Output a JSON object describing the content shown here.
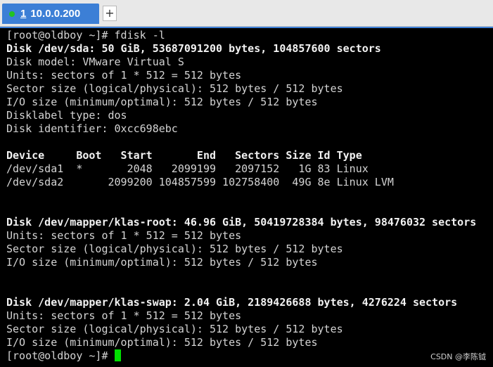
{
  "tabs": {
    "active_number": "1",
    "active_label": "10.0.0.200",
    "add_label": "+"
  },
  "terminal": {
    "lines": [
      {
        "text": "[root@oldboy ~]# fdisk -l",
        "bold": false
      },
      {
        "text": "Disk /dev/sda: 50 GiB, 53687091200 bytes, 104857600 sectors",
        "bold": true
      },
      {
        "text": "Disk model: VMware Virtual S",
        "bold": false
      },
      {
        "text": "Units: sectors of 1 * 512 = 512 bytes",
        "bold": false
      },
      {
        "text": "Sector size (logical/physical): 512 bytes / 512 bytes",
        "bold": false
      },
      {
        "text": "I/O size (minimum/optimal): 512 bytes / 512 bytes",
        "bold": false
      },
      {
        "text": "Disklabel type: dos",
        "bold": false
      },
      {
        "text": "Disk identifier: 0xcc698ebc",
        "bold": false
      },
      {
        "text": "",
        "bold": false
      },
      {
        "text": "Device     Boot   Start       End   Sectors Size Id Type",
        "bold": true
      },
      {
        "text": "/dev/sda1  *       2048   2099199   2097152   1G 83 Linux",
        "bold": false
      },
      {
        "text": "/dev/sda2       2099200 104857599 102758400  49G 8e Linux LVM",
        "bold": false
      },
      {
        "text": "",
        "bold": false
      },
      {
        "text": "",
        "bold": false
      },
      {
        "text": "Disk /dev/mapper/klas-root: 46.96 GiB, 50419728384 bytes, 98476032 sectors",
        "bold": true
      },
      {
        "text": "Units: sectors of 1 * 512 = 512 bytes",
        "bold": false
      },
      {
        "text": "Sector size (logical/physical): 512 bytes / 512 bytes",
        "bold": false
      },
      {
        "text": "I/O size (minimum/optimal): 512 bytes / 512 bytes",
        "bold": false
      },
      {
        "text": "",
        "bold": false
      },
      {
        "text": "",
        "bold": false
      },
      {
        "text": "Disk /dev/mapper/klas-swap: 2.04 GiB, 2189426688 bytes, 4276224 sectors",
        "bold": true
      },
      {
        "text": "Units: sectors of 1 * 512 = 512 bytes",
        "bold": false
      },
      {
        "text": "Sector size (logical/physical): 512 bytes / 512 bytes",
        "bold": false
      },
      {
        "text": "I/O size (minimum/optimal): 512 bytes / 512 bytes",
        "bold": false
      }
    ],
    "prompt": "[root@oldboy ~]# "
  },
  "watermark": "CSDN @李陈钺",
  "colors": {
    "tab_active": "#3c7fd6",
    "status_dot": "#22c322",
    "cursor": "#00e000",
    "terminal_bg": "#000000"
  }
}
